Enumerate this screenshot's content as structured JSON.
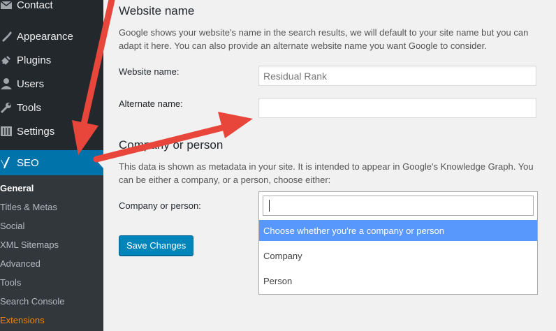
{
  "sidebar": {
    "items": [
      {
        "label": "Contact",
        "icon": "mail-icon"
      },
      {
        "label": "Appearance",
        "icon": "paintbrush-icon"
      },
      {
        "label": "Plugins",
        "icon": "plug-icon"
      },
      {
        "label": "Users",
        "icon": "user-icon"
      },
      {
        "label": "Tools",
        "icon": "wrench-icon"
      },
      {
        "label": "Settings",
        "icon": "sliders-icon"
      },
      {
        "label": "SEO",
        "icon": "yoast-icon"
      }
    ],
    "submenu": [
      "General",
      "Titles & Metas",
      "Social",
      "XML Sitemaps",
      "Advanced",
      "Tools",
      "Search Console",
      "Extensions"
    ]
  },
  "website_name": {
    "heading": "Website name",
    "description": "Google shows your website's name in the search results, we will default to your site name but you can adapt it here. You can also provide an alternate website name you want Google to consider.",
    "name_label": "Website name:",
    "name_value": "Residual Rank",
    "alt_label": "Alternate name:",
    "alt_value": ""
  },
  "company": {
    "heading": "Company or person",
    "description": "This data is shown as metadata in your site. It is intended to appear in Google's Knowledge Graph. You can be either a company, or a person, choose either:",
    "label": "Company or person:",
    "options": [
      "Choose whether you're a company or person",
      "Company",
      "Person"
    ]
  },
  "save_label": "Save Changes",
  "colors": {
    "accent": "#0073aa",
    "arrow": "#e8463a",
    "highlight": "#5897fb"
  }
}
